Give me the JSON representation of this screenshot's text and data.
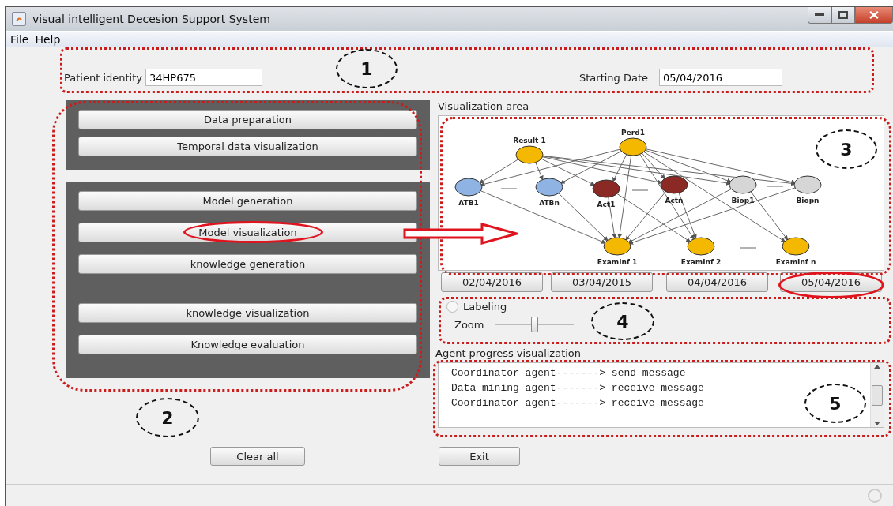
{
  "window": {
    "title": "visual intelligent Decesion Support System"
  },
  "menu": [
    {
      "label": "File"
    },
    {
      "label": "Help"
    }
  ],
  "patient": {
    "label": "Patient identity",
    "value": "34HP675"
  },
  "starting_date": {
    "label": "Starting Date",
    "value": "05/04/2016"
  },
  "left_panels": [
    {
      "buttons": [
        "Data preparation",
        "Temporal data visualization"
      ]
    },
    {
      "buttons": [
        "Model generation",
        "Model visualization",
        "knowledge generation",
        "knowledge visualization",
        "Knowledge evaluation"
      ]
    }
  ],
  "visualization": {
    "label": "Visualization area",
    "nodes": [
      {
        "label": "Result 1",
        "color": "#f5b800"
      },
      {
        "label": "Perd1",
        "color": "#f5b800"
      },
      {
        "label": "ATB1",
        "color": "#8fb4e3"
      },
      {
        "label": "ATBn",
        "color": "#8fb4e3"
      },
      {
        "label": "Act1",
        "color": "#8b2a25"
      },
      {
        "label": "Actn",
        "color": "#8b2a25"
      },
      {
        "label": "Biop1",
        "color": "#d6d6d6"
      },
      {
        "label": "Biopn",
        "color": "#d6d6d6"
      },
      {
        "label": "ExamInf 1",
        "color": "#f5b800"
      },
      {
        "label": "ExamInf 2",
        "color": "#f5b800"
      },
      {
        "label": "ExamInf n",
        "color": "#f5b800"
      }
    ]
  },
  "dates": [
    "02/04/2016",
    "03/04/2015",
    "04/04/2016",
    "05/04/2016"
  ],
  "labeling": {
    "label": "Labeling",
    "checked": false
  },
  "zoom": {
    "label": "Zoom",
    "level": 0.5
  },
  "agent_progress": {
    "label": "Agent progress visualization",
    "lines": [
      "Coordinator agent-------> send message",
      "Data mining agent-------> receive message",
      "Coordinator agent-------> receive message"
    ]
  },
  "buttons": [
    "Clear all",
    "Exit"
  ],
  "annotations": [
    {
      "label": "1"
    },
    {
      "label": "2"
    },
    {
      "label": "3"
    },
    {
      "label": "4"
    },
    {
      "label": "5"
    }
  ]
}
